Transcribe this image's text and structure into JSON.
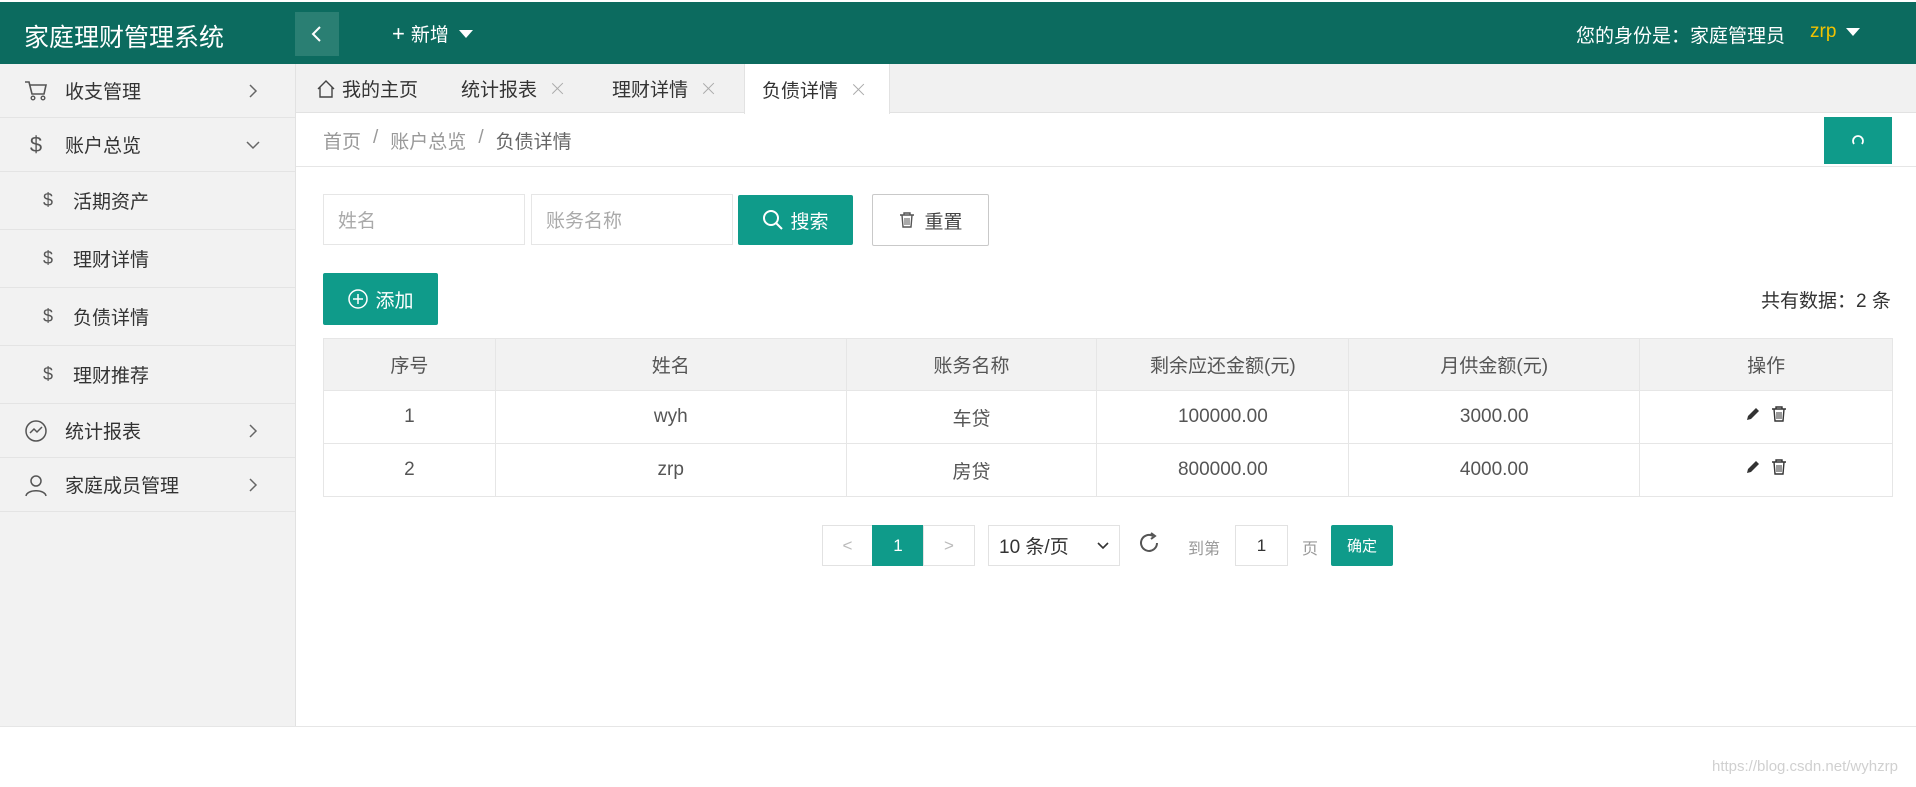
{
  "app": {
    "title": "家庭理财管理系统"
  },
  "header": {
    "add_label": "新增",
    "identity_label": "您的身份是：家庭管理员",
    "username": "zrp"
  },
  "sidebar": {
    "items": [
      {
        "label": "收支管理",
        "icon": "cart-icon"
      },
      {
        "label": "账户总览",
        "icon": "dollar-icon"
      },
      {
        "label": "活期资产",
        "icon": "dollar-icon"
      },
      {
        "label": "理财详情",
        "icon": "dollar-icon"
      },
      {
        "label": "负债详情",
        "icon": "dollar-icon"
      },
      {
        "label": "理财推荐",
        "icon": "dollar-icon"
      },
      {
        "label": "统计报表",
        "icon": "chart-icon"
      },
      {
        "label": "家庭成员管理",
        "icon": "user-icon"
      }
    ]
  },
  "tabs": [
    {
      "label": "我的主页"
    },
    {
      "label": "统计报表"
    },
    {
      "label": "理财详情"
    },
    {
      "label": "负债详情"
    }
  ],
  "breadcrumb": {
    "items": [
      "首页",
      "账户总览",
      "负债详情"
    ],
    "separator": "/"
  },
  "search": {
    "name_placeholder": "姓名",
    "account_placeholder": "账务名称",
    "search_label": "搜索",
    "reset_label": "重置"
  },
  "toolbar": {
    "add_label": "添加",
    "total_text": "共有数据：2 条"
  },
  "table": {
    "headers": [
      "序号",
      "姓名",
      "账务名称",
      "剩余应还金额(元)",
      "月供金额(元)",
      "操作"
    ],
    "rows": [
      {
        "index": "1",
        "name": "wyh",
        "account": "车贷",
        "remaining": "100000.00",
        "monthly": "3000.00"
      },
      {
        "index": "2",
        "name": "zrp",
        "account": "房贷",
        "remaining": "800000.00",
        "monthly": "4000.00"
      }
    ]
  },
  "pager": {
    "prev": "<",
    "current": "1",
    "next": ">",
    "page_size": "10 条/页",
    "goto_label": "到第",
    "goto_value": "1",
    "page_unit": "页",
    "confirm_label": "确定"
  },
  "watermark": "https://blog.csdn.net/wyhzrp",
  "colors": {
    "header": "#0c6b5f",
    "accent": "#0f9b8a",
    "username": "#f2c200"
  }
}
